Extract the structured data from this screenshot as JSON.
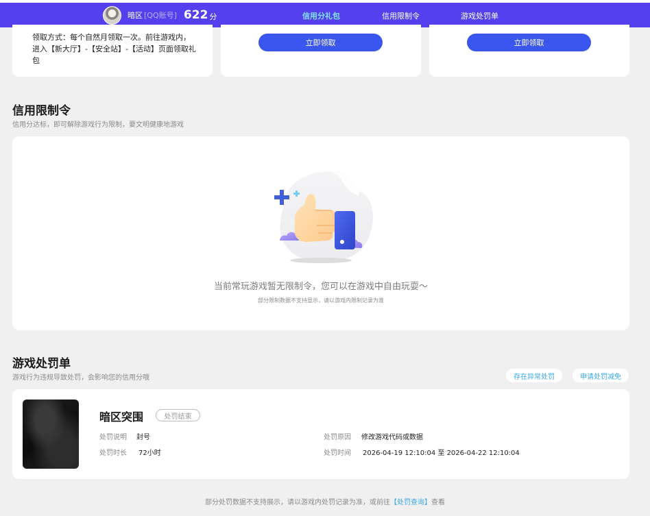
{
  "header": {
    "user_name": "暗区",
    "account_type": "[QQ账号]",
    "score": "622",
    "score_unit": "分",
    "tabs": [
      {
        "label": "信用分礼包",
        "active": true
      },
      {
        "label": "信用限制令",
        "active": false
      },
      {
        "label": "游戏处罚单",
        "active": false
      }
    ],
    "bg_color": "#5540f0",
    "active_color": "#7fe2ff"
  },
  "gift_cards": {
    "claim_desc": "领取方式：每个自然月领取一次。前往游戏内，进入【新大厅】-【安全站】-【活动】页面领取礼包",
    "buttons": [
      "立即领取",
      "立即领取"
    ],
    "button_color": "#3a56ef"
  },
  "restriction": {
    "title": "信用限制令",
    "subtitle": "信用分达标，即可解除游戏行为限制，要文明健康地游戏",
    "empty_main": "当前常玩游戏暂无限制令，您可以在游戏中自由玩耍～",
    "empty_note": "部分限制数据不支持显示，请以游戏内限制记录为准"
  },
  "penalty": {
    "title": "游戏处罚单",
    "subtitle": "游戏行为违规导致处罚，会影响您的信用分哦",
    "actions": [
      "存在异常处罚",
      "申请处罚减免"
    ],
    "item": {
      "game_name": "暗区突围",
      "status": "处罚结束",
      "desc_label": "处罚说明",
      "desc_value": "封号",
      "duration_label": "处罚时长",
      "duration_value": "72小时",
      "reason_label": "处罚原因",
      "reason_value": "修改游戏代码或数据",
      "time_label": "处罚时间",
      "time_value": "2026-04-19 12:10:04 至 2026-04-22 12:10:04"
    },
    "footer_prefix": "部分处罚数据不支持展示，请以游戏内处罚记录为准，或前往",
    "footer_link": "【处罚查询】",
    "footer_suffix": "查看",
    "link_color": "#3aa8e8"
  }
}
